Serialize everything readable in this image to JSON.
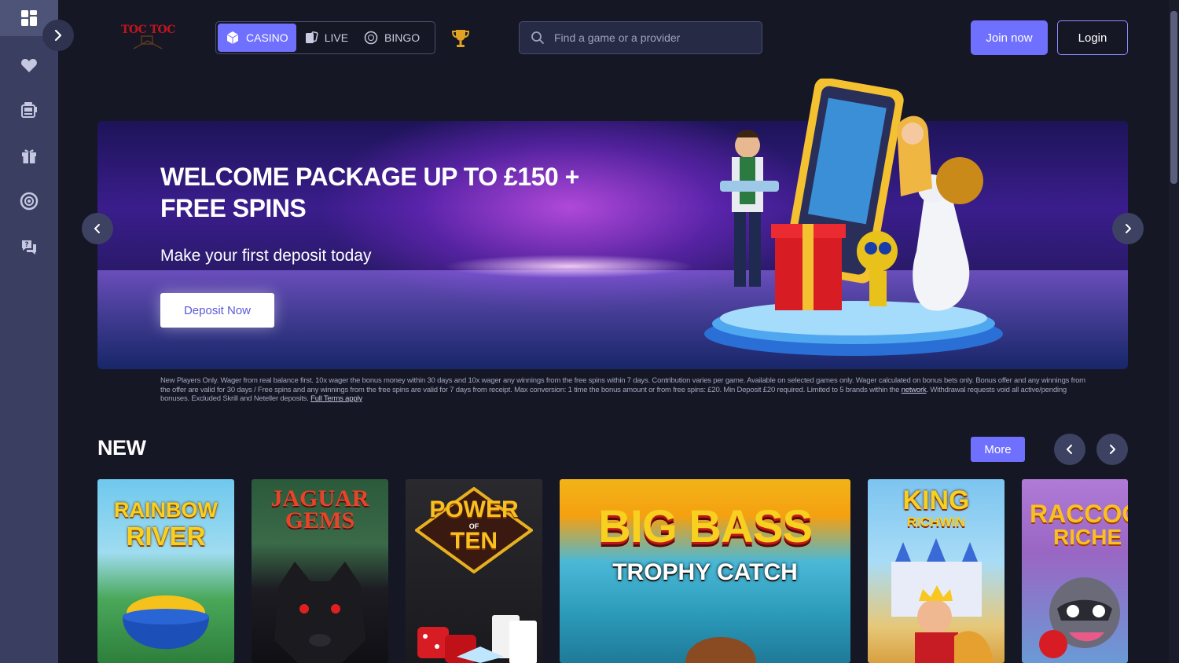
{
  "brand": {
    "logo_text": "TOC TOC"
  },
  "sidebar": {
    "items": [
      {
        "name": "dashboard-icon"
      },
      {
        "name": "heart-icon"
      },
      {
        "name": "slot-machine-icon"
      },
      {
        "name": "gift-icon"
      },
      {
        "name": "chip-icon"
      },
      {
        "name": "help-chat-icon"
      }
    ]
  },
  "header": {
    "tabs": [
      {
        "label": "CASINO",
        "icon": "dice-icon",
        "active": true
      },
      {
        "label": "LIVE",
        "icon": "cards-icon",
        "active": false
      },
      {
        "label": "BINGO",
        "icon": "bingo-ball-icon",
        "active": false
      }
    ],
    "search_placeholder": "Find a game or a provider",
    "join_label": "Join now",
    "login_label": "Login"
  },
  "banner": {
    "title": "WELCOME PACKAGE UP TO £150 + FREE SPINS",
    "subtitle": "Make your first deposit today",
    "cta": "Deposit Now",
    "terms": "New Players Only. Wager from real balance first. 10x wager the bonus money within 30 days and 10x wager any winnings from the free spins within 7 days. Contribution varies per game. Available on selected games only. Wager calculated on bonus bets only. Bonus offer and any winnings from the offer are valid for 30 days / Free spins and any winnings from the free spins are valid for 7 days from receipt. Max conversion: 1 time the bonus amount or from free spins: £20. Min Deposit £20 required. Limited to 5 brands within the",
    "terms_link1": "network",
    "terms_mid": ". Withdrawal requests void all active/pending bonuses. Excluded Skrill and Neteller deposits.",
    "terms_link2": "Full Terms apply"
  },
  "new_section": {
    "title": "NEW",
    "more_label": "More",
    "games": [
      {
        "line1": "RAINBOW",
        "line2": "RIVER"
      },
      {
        "line1": "JAGUAR",
        "line2": "GEMS"
      },
      {
        "line1": "POWER",
        "line2": "TEN",
        "small": "OF"
      },
      {
        "line1": "BIG BASS",
        "line2": "TROPHY CATCH"
      },
      {
        "line1": "KING",
        "line2": "RICHWIN"
      },
      {
        "line1": "RACCOO",
        "line2": "RICHE"
      }
    ]
  },
  "colors": {
    "accent": "#7070ff",
    "bg": "#161725",
    "sidebar": "#3a3f62"
  }
}
